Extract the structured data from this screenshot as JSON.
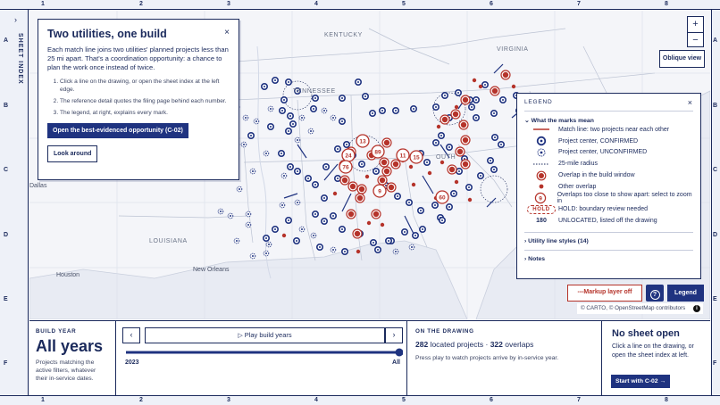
{
  "frame": {
    "col_numbers": [
      "1",
      "2",
      "3",
      "4",
      "5",
      "6",
      "7",
      "8"
    ],
    "row_letters": [
      "A",
      "B",
      "C",
      "D",
      "E",
      "F"
    ],
    "sheet_index_label": "SHEET INDEX",
    "sheet_index_chevron": "›"
  },
  "map": {
    "state_labels": [
      "KENTUCKY",
      "VIRGINIA",
      "TENNESSEE",
      "LOUISIANA"
    ],
    "city_labels": [
      "Dallas",
      "Houston",
      "New Orleans"
    ],
    "cluster_counts": [
      "13",
      "24",
      "89",
      "11",
      "15",
      "76",
      "9",
      "60"
    ],
    "partial_label": "OUTH"
  },
  "intro": {
    "title": "Two utilities, one build",
    "close_label": "×",
    "body": "Each match line joins two utilities' planned projects less than 25 mi apart. That's a coordination opportunity: a chance to plan the work once instead of twice.",
    "steps": [
      "Click a line on the drawing, or open the sheet index at the left edge.",
      "The reference detail quotes the filing page behind each number.",
      "The legend, at right, explains every mark."
    ],
    "primary_button": "Open the best-evidenced opportunity (C-02)",
    "secondary_button": "Look around"
  },
  "zoom": {
    "in_label": "+",
    "out_label": "−"
  },
  "oblique_view_label": "Oblique view",
  "legend": {
    "title": "LEGEND",
    "close_label": "×",
    "section_marks": "What the marks mean",
    "items": [
      {
        "symbol": "match-line",
        "label": "Match line: two projects near each other"
      },
      {
        "symbol": "confirmed",
        "label": "Project center, CONFIRMED"
      },
      {
        "symbol": "unconfirmed",
        "label": "Project center, UNCONFIRMED"
      },
      {
        "symbol": "radius",
        "label": "25-mile radius"
      },
      {
        "symbol": "overlap-window",
        "label": "Overlap in the build window"
      },
      {
        "symbol": "overlap-other",
        "label": "Other overlap"
      },
      {
        "symbol": "overlap-cluster",
        "cluster_label": "9",
        "label": "Overlaps too close to show apart: select to zoom in"
      },
      {
        "symbol": "hold",
        "hold_label": "HOLD",
        "label": "HOLD: boundary review needed"
      },
      {
        "symbol": "count",
        "count_label": "180",
        "label": "UNLOCATED, listed off the drawing"
      }
    ],
    "section_line_styles": "Utility line styles (14)",
    "section_notes": "Notes"
  },
  "markup_button": "Markup layer off",
  "help_button": "?",
  "legend_button": "Legend",
  "attribution": "© CARTO, © OpenStreetMap contributors",
  "build_year": {
    "kicker": "BUILD YEAR",
    "value": "All years",
    "description": "Projects matching the active filters, whatever their in-service dates.",
    "play_label": "Play build years",
    "prev_label": "‹",
    "next_label": "›",
    "slider_start": "2023",
    "slider_end": "All",
    "slider_fraction": 1.0
  },
  "on_drawing": {
    "kicker": "ON THE DRAWING",
    "located_count": "282",
    "located_label": "located projects",
    "separator": "·",
    "overlap_count": "322",
    "overlap_label": "overlaps",
    "description": "Press play to watch projects arrive by in-service year."
  },
  "sheet": {
    "title": "No sheet open",
    "description": "Click a line on the drawing, or open the sheet index at left.",
    "button": "Start with C-02",
    "button_arrow": "→"
  },
  "colors": {
    "navy": "#1b2a5c",
    "primary": "#1f3380",
    "overlap_red": "#b5332a",
    "paper": "#f4f5f9"
  }
}
